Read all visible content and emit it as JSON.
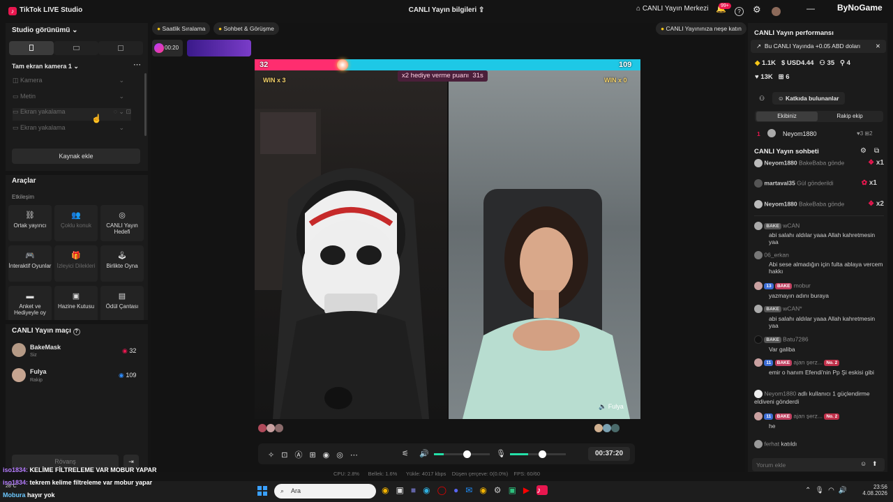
{
  "app": {
    "title": "TikTok LIVE Studio",
    "center_title": "CANLI Yayın bilgileri",
    "center_label": "CANLI Yayın Merkezi",
    "notif_count": "99+",
    "watermark": "ByNoGame"
  },
  "left": {
    "studio_view": "Studio görünümü",
    "scene": "Tam ekran kamera 1",
    "sources": [
      {
        "label": "Kamera",
        "icon": "camera-icon"
      },
      {
        "label": "Metin",
        "icon": "text-icon"
      },
      {
        "label": "Ekran yakalama",
        "icon": "monitor-icon"
      },
      {
        "label": "Ekran yakalama",
        "icon": "monitor-icon"
      }
    ],
    "add_source": "Kaynak ekle",
    "tools_title": "Araçlar",
    "interaction": "Etkileşim",
    "tools": [
      {
        "label": "Ortak yayıncı",
        "icon": "link-icon",
        "enabled": true
      },
      {
        "label": "Çoklu konuk",
        "icon": "users-icon",
        "enabled": false
      },
      {
        "label": "CANLI Yayın Hedefi",
        "icon": "target-icon",
        "enabled": true
      },
      {
        "label": "İnteraktif Oyunlar",
        "icon": "gamepad-icon",
        "enabled": true
      },
      {
        "label": "İzleyici Dilekleri",
        "icon": "gift-icon",
        "enabled": false
      },
      {
        "label": "Birlikte Oyna",
        "icon": "joystick-icon",
        "enabled": true
      },
      {
        "label": "Anket ve Hediyeyle oy",
        "icon": "poll-icon",
        "enabled": true
      },
      {
        "label": "Hazine Kutusu",
        "icon": "chest-icon",
        "enabled": true
      },
      {
        "label": "Ödül Çantası",
        "icon": "bag-icon",
        "enabled": true
      }
    ],
    "match_title": "CANLI Yayın maçı",
    "match": [
      {
        "name": "BakeMask",
        "role": "Siz",
        "score": "32",
        "color": "#e8174f"
      },
      {
        "name": "Fulya",
        "role": "Rakip",
        "score": "109",
        "color": "#2e8cff"
      }
    ],
    "replay": "Rövanş"
  },
  "center": {
    "chips": [
      "Saatlik Sıralama",
      "Sohbet & Görüşme"
    ],
    "right_chip": "CANLI Yayınınıza neşe katın",
    "timer_chip": "00:20",
    "battle": {
      "left_score": "32",
      "right_score": "109",
      "left_win": "WIN x 3",
      "right_win": "WIN x 0",
      "banner": "x2 hediye verme puanı",
      "countdown": "31s",
      "right_name": "Fulya",
      "left_share": 0.227
    },
    "elapsed": "00:37:20",
    "stats": {
      "cpu": "CPU: 2.8%",
      "memory": "Bellek: 1.6%",
      "upload": "Yükle: 4017 kbps",
      "dropped": "Düşen çerçeve: 0(0.0%)",
      "fps": "FPS: 60/60"
    }
  },
  "right": {
    "perf_title": "CANLI Yayın performansı",
    "perf_banner": "Bu CANLI Yayında +0.05 ABD doları",
    "metrics": [
      {
        "icon": "diamond-icon",
        "value": "1.1K"
      },
      {
        "icon": "dollar-icon",
        "value": "USD4.44"
      },
      {
        "icon": "viewers-icon",
        "value": "35"
      },
      {
        "icon": "follow-icon",
        "value": "4"
      },
      {
        "icon": "heart-icon",
        "value": "13K"
      },
      {
        "icon": "gift-icon",
        "value": "6"
      }
    ],
    "contributors": "Katkıda bulunanlar",
    "tabs": [
      "Ekibiniz",
      "Rakip ekip"
    ],
    "top_contributor": {
      "rank": "1",
      "name": "Neyom1880",
      "likes": "3",
      "gifts": "2"
    },
    "chat_title": "CANLI Yayın sohbeti",
    "gifts": [
      {
        "user": "Neyom1880",
        "text": "BakeBaba gönde",
        "count": "x1"
      },
      {
        "user": "martaval35",
        "text": "Gül gönderildi",
        "count": "x1"
      },
      {
        "user": "Neyom1880",
        "text": "BakeBaba gönde",
        "count": "x2"
      }
    ],
    "messages": [
      {
        "user": "wCAN",
        "level": "",
        "fan": "BAKE",
        "text": "abi salahı aldılar yaaa Allah kahretmesin yaa"
      },
      {
        "user": "06_erkan",
        "level": "",
        "fan": "",
        "text": "Abi sese almadığın için fulta ablaya vercem hakkı"
      },
      {
        "user": "mobur",
        "level": "13",
        "fan": "BAKE",
        "text": "yazmayın adını buraya"
      },
      {
        "user": "wCAN*",
        "level": "",
        "fan": "BAKE",
        "text": "abi salahı aldılar yaaa Allah kahretmesin yaa"
      },
      {
        "user": "Batu7286",
        "level": "",
        "fan": "BAKE",
        "text": "Var galiba"
      },
      {
        "user": "ajan şerz...",
        "level": "11",
        "fan": "BAKE",
        "rank": "No. 2",
        "text": "emir o hanım Efendi'nin Pp Şi eskisi gibi"
      },
      {
        "user": "Neyom1880",
        "level": "",
        "fan": "",
        "text": "adlı kullanıcı 1 güçlendirme eldiveni gönderdi"
      },
      {
        "user": "ajan şerz...",
        "level": "11",
        "fan": "BAKE",
        "rank": "No. 2",
        "text": "he"
      },
      {
        "user": "ferhat",
        "level": "",
        "fan": "",
        "text": "katıldı"
      }
    ],
    "comment_placeholder": "Yorum ekle"
  },
  "overlay": {
    "lines": [
      {
        "user": "iso1834:",
        "text": "KELİME FİLTRELEME VAR MOBUR YAPAR"
      },
      {
        "user": "iso1834:",
        "text": "tekrem kelime filtreleme var mobur yapar"
      },
      {
        "user": "Mobura",
        "text": "hayır yok"
      }
    ]
  },
  "taskbar": {
    "search": "Ara",
    "weather": "28°C",
    "time": "23:56",
    "date": "4.08.2026"
  }
}
